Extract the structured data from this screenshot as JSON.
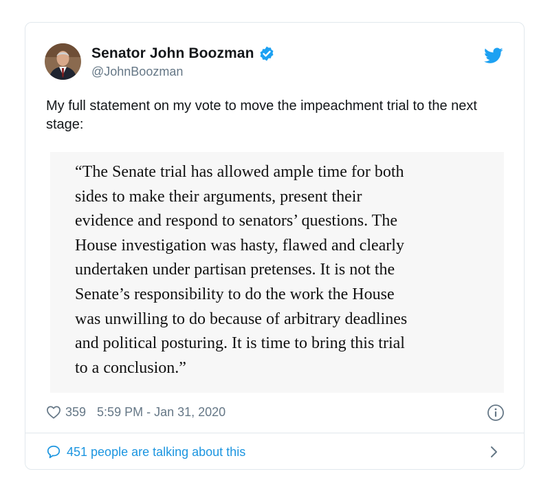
{
  "tweet": {
    "author": {
      "display_name": "Senator John Boozman",
      "handle": "@JohnBoozman",
      "verified": true,
      "avatar_icon": "avatar-photo"
    },
    "text": "My full statement on my vote to move the impeachment trial to the next stage:",
    "quote_lines": [
      "“The Senate trial has allowed ample time for both",
      "sides to make their arguments, present their",
      "evidence and respond to senators’ questions. The",
      "House investigation was hasty, flawed and clearly",
      "undertaken under partisan pretenses. It is not the",
      "Senate’s responsibility to do the work the House",
      "was unwilling to do because of arbitrary deadlines",
      "and political posturing. It is time to bring this trial",
      "to a conclusion.”"
    ],
    "like_count": "359",
    "timestamp": "5:59 PM - Jan 31, 2020",
    "conversation_label": "451 people are talking about this"
  },
  "icons": {
    "verified": "verified-badge-icon",
    "brand": "twitter-bird-icon",
    "like": "heart-icon",
    "info": "info-icon",
    "reply": "speech-bubble-icon",
    "chevron": "chevron-right-icon"
  },
  "colors": {
    "brand_blue": "#1da1f2",
    "link_blue": "#1b95e0",
    "secondary_text": "#657786",
    "border": "#e1e8ed",
    "quote_background": "#f7f7f7"
  }
}
